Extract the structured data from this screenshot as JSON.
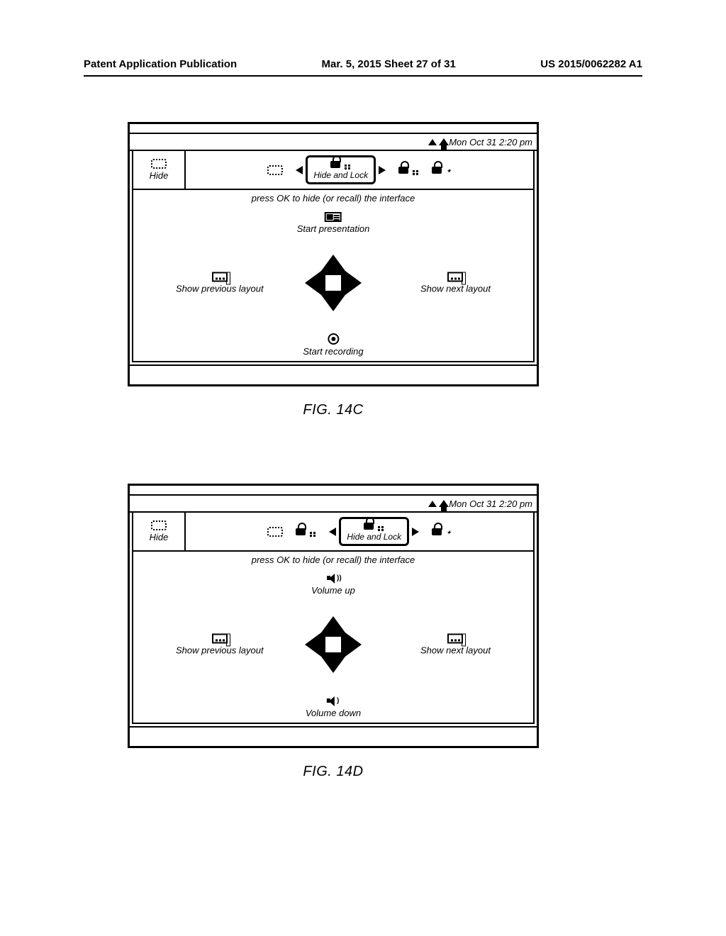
{
  "header": {
    "left": "Patent Application Publication",
    "center": "Mar. 5, 2015  Sheet 27 of 31",
    "right": "US 2015/0062282 A1"
  },
  "figC": {
    "timestamp": "Mon Oct 31 2:20 pm",
    "hide_label": "Hide",
    "selected_label": "Hide and Lock",
    "hint": "press OK to hide (or recall) the interface",
    "up_label": "Start presentation",
    "down_label": "Start recording",
    "left_label": "Show previous layout",
    "right_label": "Show next layout",
    "caption": "FIG. 14C"
  },
  "figD": {
    "timestamp": "Mon Oct 31 2:20 pm",
    "hide_label": "Hide",
    "selected_label": "Hide and Lock",
    "hint": "press OK to hide (or recall) the interface",
    "up_label": "Volume up",
    "down_label": "Volume down",
    "left_label": "Show previous layout",
    "right_label": "Show next layout",
    "caption": "FIG. 14D"
  }
}
